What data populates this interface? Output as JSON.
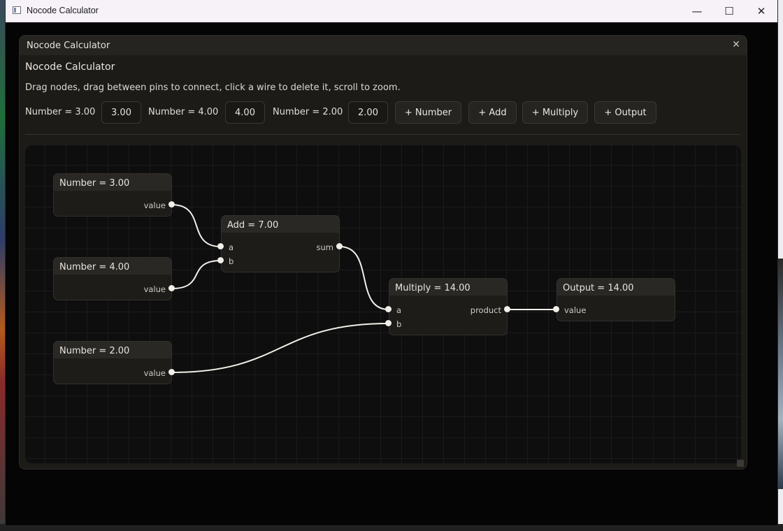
{
  "window": {
    "title": "Nocode Calculator",
    "minimize": "—",
    "maximize": "☐",
    "close": "✕"
  },
  "panel": {
    "title": "Nocode Calculator",
    "close": "✕",
    "heading": "Nocode Calculator",
    "description": "Drag nodes, drag between pins to connect, click a wire to delete it, scroll to zoom."
  },
  "toolbar": {
    "number_fields": [
      {
        "label": "Number = 3.00",
        "value": "3.00"
      },
      {
        "label": "Number = 4.00",
        "value": "4.00"
      },
      {
        "label": "Number = 2.00",
        "value": "2.00"
      }
    ],
    "buttons": {
      "add_number": "+ Number",
      "add_add": "+ Add",
      "add_multiply": "+ Multiply",
      "add_output": "+ Output"
    }
  },
  "nodes": {
    "number1": {
      "title": "Number = 3.00",
      "out": "value"
    },
    "number2": {
      "title": "Number = 4.00",
      "out": "value"
    },
    "number3": {
      "title": "Number = 2.00",
      "out": "value"
    },
    "add": {
      "title": "Add = 7.00",
      "in_a": "a",
      "in_b": "b",
      "out": "sum"
    },
    "multiply": {
      "title": "Multiply = 14.00",
      "in_a": "a",
      "in_b": "b",
      "out": "product"
    },
    "output": {
      "title": "Output = 14.00",
      "in": "value"
    }
  },
  "colors": {
    "wire": "#f2efe9",
    "canvas_bg": "#0e0e0e",
    "node_bg": "#1e1c19"
  }
}
